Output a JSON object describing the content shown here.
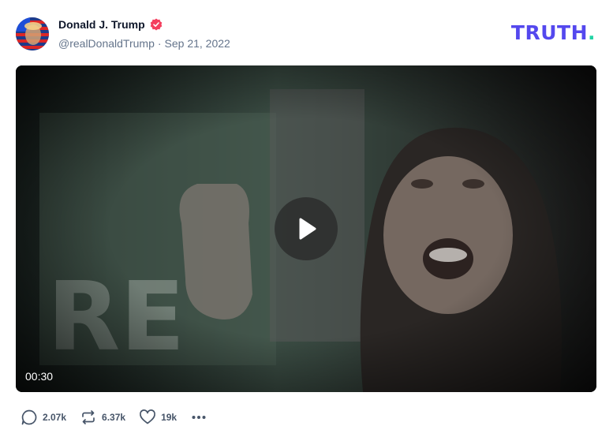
{
  "post": {
    "author_name": "Donald J. Trump",
    "handle": "@realDonaldTrump",
    "separator": "·",
    "date": "Sep 21, 2022",
    "verified_icon": "verified-badge-icon",
    "avatar_icon": "avatar-image"
  },
  "brand": {
    "logo_text": "TRUTH",
    "logo_dot": ".",
    "logo_color": "#5448ee",
    "dot_color": "#22d3a4"
  },
  "video": {
    "duration": "00:30",
    "play_icon": "play-icon"
  },
  "actions": {
    "replies": "2.07k",
    "retruths": "6.37k",
    "likes": "19k",
    "reply_icon": "comment-icon",
    "retruth_icon": "repost-icon",
    "like_icon": "heart-icon",
    "more_icon": "more-icon"
  },
  "colors": {
    "verified": "#f43f5e",
    "muted_text": "#64748b"
  }
}
